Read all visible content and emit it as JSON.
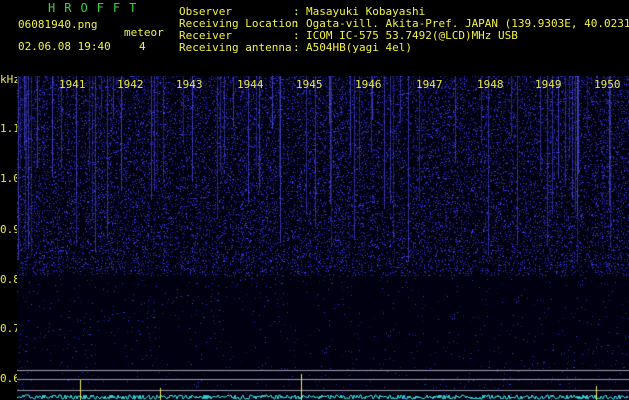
{
  "header": {
    "app_title": "HROFFT",
    "filename": "06081940.png",
    "datetime": "02.06.08 19:40",
    "meteor_label": "meteor",
    "meteor_count": "4",
    "fields": [
      {
        "label": "Observer",
        "value": "Masayuki Kobayashi"
      },
      {
        "label": "Receiving Location",
        "value": "Ogata-vill. Akita-Pref. JAPAN (139.9303E, 40.0231N)"
      },
      {
        "label": "Receiver",
        "value": "ICOM IC-575 53.7492(@LCD)MHz USB"
      },
      {
        "label": "Receiving antenna",
        "value": "A504HB(yagi 4el)"
      }
    ]
  },
  "spectrogram": {
    "y_unit": "kHz",
    "y_ticks": [
      "1.1",
      "1.0",
      "0.9",
      "0.8",
      "0.7",
      "0.6"
    ],
    "x_ticks": [
      "1941",
      "1942",
      "1943",
      "1944",
      "1945",
      "1946",
      "1947",
      "1948",
      "1949",
      "1950"
    ],
    "colors": {
      "background": "#000010",
      "signal": "#3c3cff",
      "label": "#e8e84a",
      "trace": "#38e8e8",
      "marker": "#e8e85a"
    }
  }
}
